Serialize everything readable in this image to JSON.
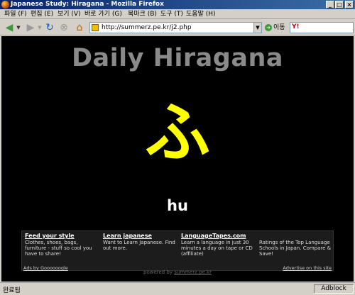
{
  "window": {
    "title": "Japanese Study: Hiragana - Mozilla Firefox"
  },
  "menu": [
    "파일 (F)",
    "편집 (E)",
    "보기 (V)",
    "바로 가기 (G)",
    "북마크 (B)",
    "도구 (T)",
    "도움말 (H)"
  ],
  "nav": {
    "url": "http://summerz.pe.kr/j2.php",
    "go_label": "이동",
    "search_engine": "Y!"
  },
  "page": {
    "title": "Daily Hiragana",
    "character": "ふ",
    "romaji": "hu",
    "character_color": "#ffff00"
  },
  "ads": {
    "items": [
      {
        "title": "Feed your style",
        "text": "Clothes, shoes, bags, furniture - stuff so cool you have to share!"
      },
      {
        "title": "Learn japanese",
        "text": "Want to Learn Japanese. Find out more."
      },
      {
        "title": "LanguageTapes.com",
        "text": "Learn a language in just 30 minutes a day on tape or CD (affiliate)"
      },
      {
        "title": "",
        "text": "Ratings of the Top Language Schools in Japan. Compare & Save!"
      }
    ],
    "ads_by": "Ads by Goooooogle",
    "advertise": "Advertise on this site"
  },
  "footer": {
    "powered_prefix": "powered by ",
    "powered_link": "summerz.pe.kr"
  },
  "status": {
    "text": "완료됨",
    "addon": "Adblock"
  }
}
